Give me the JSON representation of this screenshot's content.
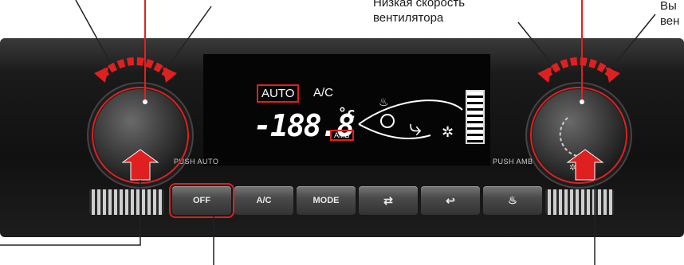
{
  "annotations": {
    "fan_low_label": "Низкая скорость вентилятора",
    "top_left_partial": "",
    "top_right_partial": "Вы\nвен"
  },
  "display": {
    "auto": "AUTO",
    "ac": "A/C",
    "temperature": "-188.8",
    "unit": "°c",
    "amb": "AMB"
  },
  "knobs": {
    "left_label": "PUSH AUTO",
    "right_label": "PUSH AMB"
  },
  "buttons": [
    {
      "label": "OFF",
      "selected": true
    },
    {
      "label": "A/C",
      "selected": false
    },
    {
      "label": "MODE",
      "selected": false
    },
    {
      "label": "recirc",
      "icon": "recirculation-icon"
    },
    {
      "label": "fresh",
      "icon": "fresh-air-icon"
    },
    {
      "label": "defrost",
      "icon": "defrost-icon"
    }
  ],
  "colors": {
    "accent": "#e02020",
    "panel": "#151515",
    "text": "#ffffff"
  }
}
